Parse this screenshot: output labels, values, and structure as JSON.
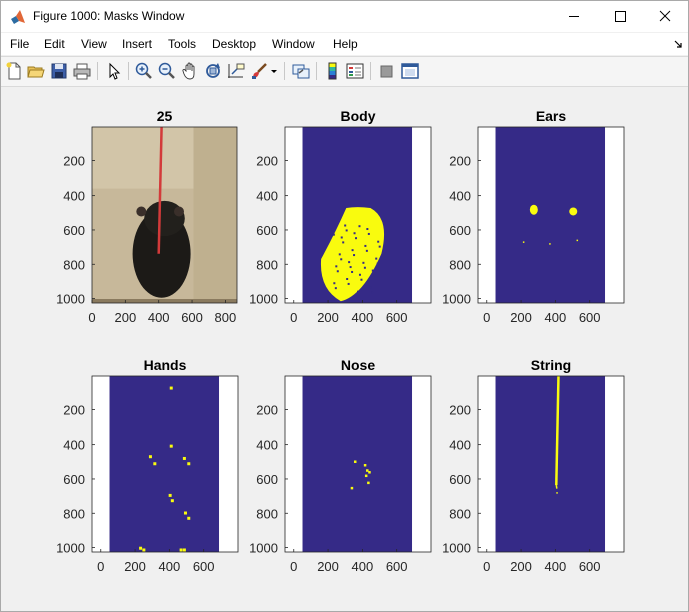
{
  "window": {
    "title": "Figure 1000: Masks Window"
  },
  "menu": [
    "File",
    "Edit",
    "View",
    "Insert",
    "Tools",
    "Desktop",
    "Window",
    "Help"
  ],
  "toolbar": {
    "icons": [
      "new-figure-icon",
      "open-file-icon",
      "save-icon",
      "print-icon",
      "edit-plot-arrow-icon",
      "zoom-in-icon",
      "zoom-out-icon",
      "pan-hand-icon",
      "rotate-3d-icon",
      "data-cursor-icon",
      "brush-icon",
      "brush-dropdown-icon",
      "link-plot-icon",
      "colorbar-icon",
      "legend-icon",
      "hide-plot-tools-icon",
      "show-plot-tools-icon"
    ]
  },
  "colors": {
    "mask_background": "#352a87",
    "mask_foreground": "#f9fb0e",
    "figure_background": "#f0f0f0",
    "string_red": "#d33a3a"
  },
  "axes": {
    "y_ticks": [
      "200",
      "400",
      "600",
      "800",
      "1000"
    ],
    "x_ticks_wide": [
      "0",
      "200",
      "400",
      "600",
      "800"
    ],
    "x_ticks_narrow": [
      "0",
      "200",
      "400",
      "600"
    ]
  },
  "subplots": [
    {
      "title": "25",
      "kind": "photo"
    },
    {
      "title": "Body",
      "kind": "mask"
    },
    {
      "title": "Ears",
      "kind": "mask"
    },
    {
      "title": "Hands",
      "kind": "mask"
    },
    {
      "title": "Nose",
      "kind": "mask"
    },
    {
      "title": "String",
      "kind": "mask"
    }
  ]
}
